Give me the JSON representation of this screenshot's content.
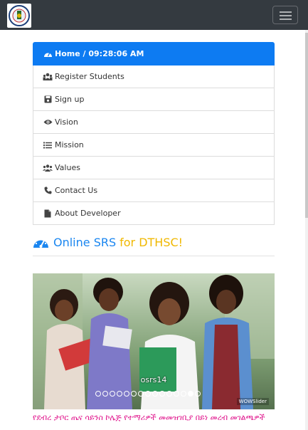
{
  "navbar": {
    "toggle_label": "Toggle navigation"
  },
  "menu": {
    "items": [
      {
        "icon": "dashboard-icon",
        "label": "Home",
        "time": "09:28:06 AM",
        "active": true
      },
      {
        "icon": "users-icon",
        "label": "Register Students"
      },
      {
        "icon": "save-icon",
        "label": "Sign up"
      },
      {
        "icon": "eye-icon",
        "label": "Vision"
      },
      {
        "icon": "list-icon",
        "label": "Mission"
      },
      {
        "icon": "group-icon",
        "label": "Values"
      },
      {
        "icon": "phone-icon",
        "label": "Contact Us"
      },
      {
        "icon": "file-icon",
        "label": "About Developer"
      }
    ],
    "separator": " / "
  },
  "heading": {
    "icon": "dashboard-icon",
    "part1": "Online SRS",
    "part2": "for DTHSC!"
  },
  "slider": {
    "caption": "osrs14",
    "dots": 15,
    "active_dot": 13,
    "watermark": "WOWSlider"
  },
  "footer": {
    "text": "የደብረ ታቦር ጤና ሳይንስ ኮሌጅ የተማሪዎች መመዝገቢያ በይነ መረብ መገልጫዎች"
  },
  "colors": {
    "navbar": "#343a40",
    "active": "#0d7bf2",
    "blue_text": "#1a86f0",
    "yellow_text": "#f0b800",
    "footer_text": "#e0148c"
  }
}
